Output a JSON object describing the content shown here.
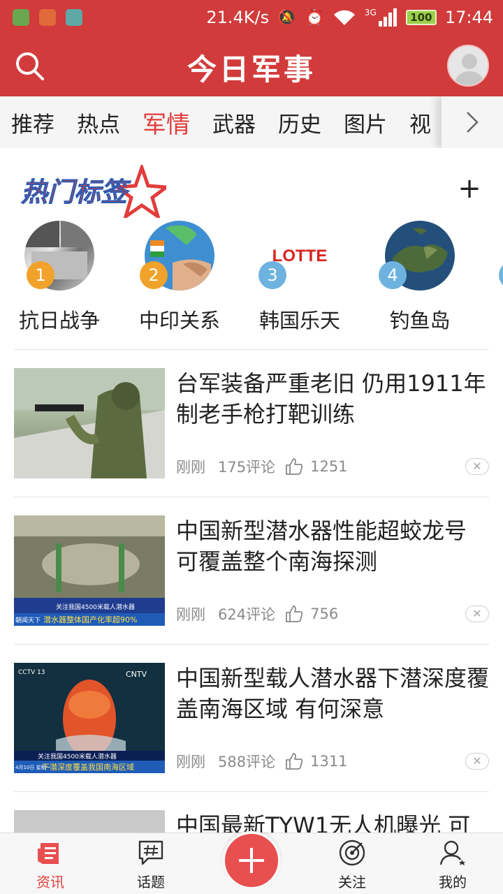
{
  "status_bar": {
    "net_speed": "21.4K/s",
    "network_type": "3G",
    "battery": "100",
    "time": "17:44"
  },
  "header": {
    "title": "今日军事"
  },
  "tabs": {
    "items": [
      "推荐",
      "热点",
      "军情",
      "武器",
      "历史",
      "图片",
      "视"
    ],
    "active": "军情"
  },
  "hot_tags": {
    "title": "热门标签",
    "add_label": "+",
    "items": [
      {
        "rank": "1",
        "label": "抗日战争"
      },
      {
        "rank": "2",
        "label": "中印关系"
      },
      {
        "rank": "3",
        "label": "韩国乐天",
        "image_text": "LOTTE"
      },
      {
        "rank": "4",
        "label": "钓鱼岛"
      }
    ]
  },
  "news": [
    {
      "title": "台军装备严重老旧 仍用1911年制老手枪打靶训练",
      "time": "刚刚",
      "comments": "175评论",
      "likes": "1251"
    },
    {
      "title": "中国新型潜水器性能超蛟龙号 可覆盖整个南海探测",
      "time": "刚刚",
      "comments": "624评论",
      "likes": "756",
      "thumb_caption_top": "关注我国4500米载人潜水器",
      "thumb_caption_bottom": "潜水器整体国产化率超90%",
      "thumb_tag": "朝闻天下"
    },
    {
      "title": "中国新型载人潜水器下潜深度覆盖南海区域 有何深意",
      "time": "刚刚",
      "comments": "588评论",
      "likes": "1311",
      "thumb_caption_top": "关注我国4500米载人潜水器",
      "thumb_caption_bottom": "下潜深度覆盖我国南海区域",
      "thumb_logo": "CCTV 13",
      "thumb_logo2": "CNTV",
      "thumb_date": "4月10日 星期一"
    },
    {
      "title": "中国最新TYW1无人机曝光 可"
    }
  ],
  "bottom_nav": {
    "items": [
      {
        "label": "资讯",
        "icon": "news-icon",
        "active": true
      },
      {
        "label": "话题",
        "icon": "topic-icon",
        "active": false
      },
      {
        "label": "关注",
        "icon": "follow-icon",
        "active": false
      },
      {
        "label": "我的",
        "icon": "profile-icon",
        "active": false
      }
    ],
    "fab_icon": "plus-icon"
  },
  "colors": {
    "brand_red": "#d13b3b",
    "active_red": "#e23c3c"
  }
}
